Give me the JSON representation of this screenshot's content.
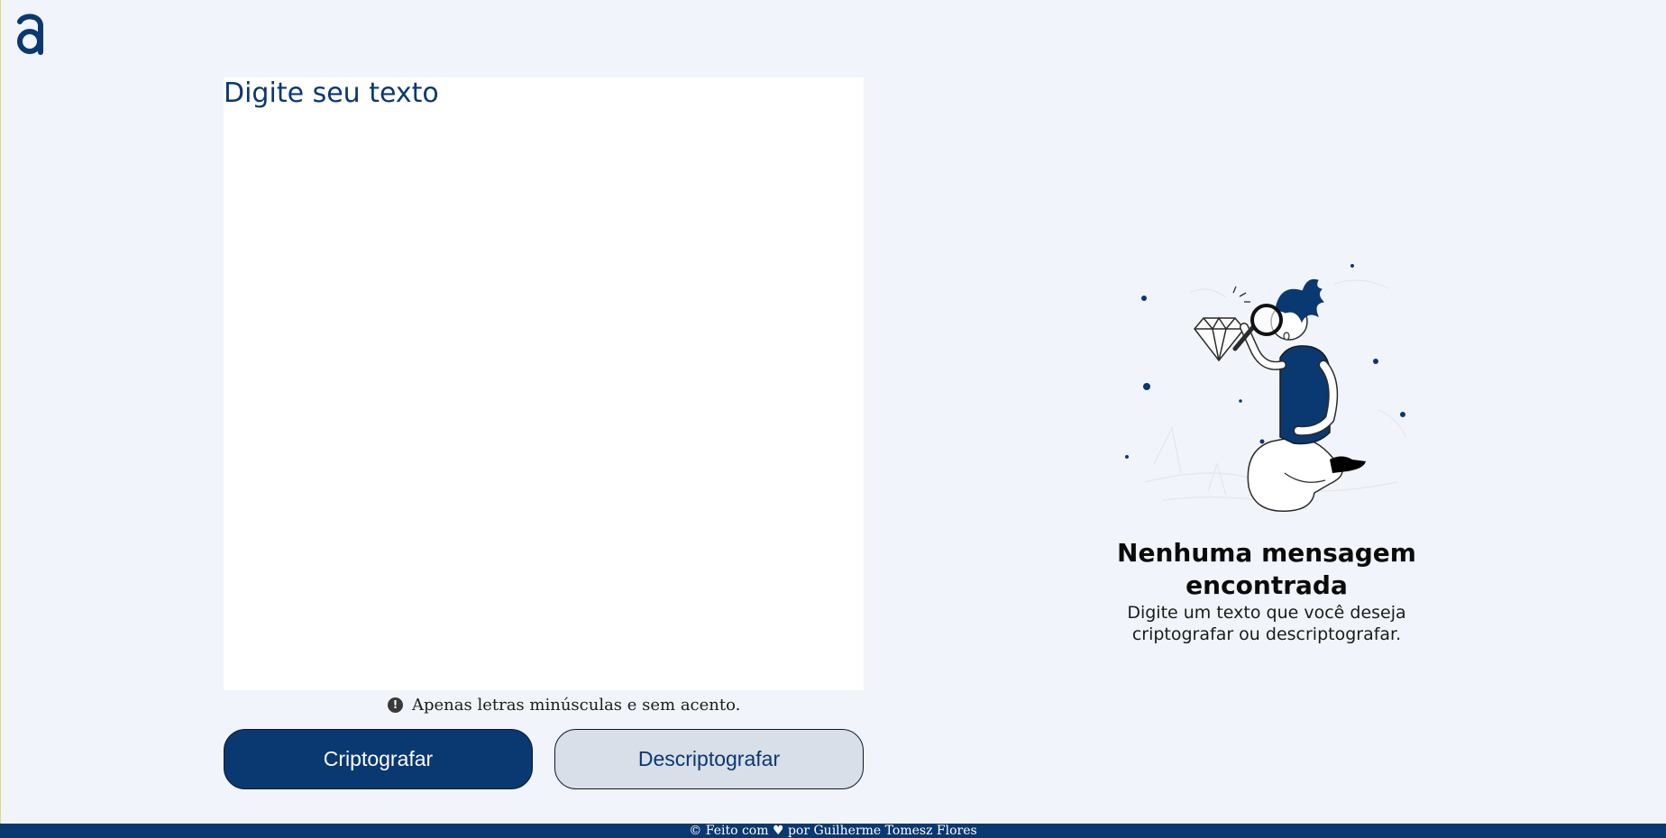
{
  "input": {
    "placeholder": "Digite seu texto",
    "value": ""
  },
  "hint": {
    "icon": "exclamation-circle-icon",
    "text": "Apenas letras minúsculas e sem acento."
  },
  "buttons": {
    "encrypt_label": "Criptografar",
    "decrypt_label": "Descriptografar"
  },
  "output": {
    "illustration": "person-with-magnifier-diamond-illustration",
    "title": "Nenhuma mensagem encontrada",
    "text": "Digite um texto que você deseja criptografar ou descriptografar."
  },
  "footer": {
    "text": "© Feito com ♥ por Guilherme Tomesz Flores"
  },
  "colors": {
    "primary": "#0a3871",
    "background": "#f1f5fb",
    "secondary_button": "#d8dfe8"
  }
}
